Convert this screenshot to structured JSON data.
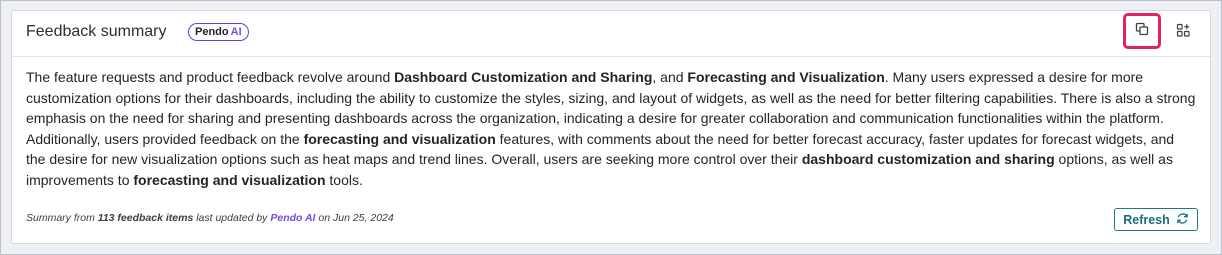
{
  "header": {
    "title": "Feedback summary",
    "badge_main": "Pendo",
    "badge_ai": "AI"
  },
  "icons": {
    "copy": "copy-icon",
    "widget": "add-widget-icon",
    "refresh": "refresh-icon"
  },
  "summary": {
    "p1": "The feature requests and product feedback revolve around ",
    "b1": "Dashboard Customization and Sharing",
    "p2": ", and ",
    "b2": "Forecasting and Visualization",
    "p3": ". Many users expressed a desire for more customization options for their dashboards, including the ability to customize the styles, sizing, and layout of widgets, as well as the need for better filtering capabilities. There is also a strong emphasis on the need for sharing and presenting dashboards across the organization, indicating a desire for greater collaboration and communication functionalities within the platform. Additionally, users provided feedback on the ",
    "b3": "forecasting and visualization",
    "p4": " features, with comments about the need for better forecast accuracy, faster updates for forecast widgets, and the desire for new visualization options such as heat maps and trend lines. Overall, users are seeking more control over their ",
    "b4": "dashboard customization and sharing",
    "p5": " options, as well as improvements to ",
    "b5": "forecasting and visualization",
    "p6": " tools."
  },
  "footer": {
    "prefix": "Summary from ",
    "count": "113 feedback items",
    "mid": " last updated by ",
    "author": "Pendo AI",
    "date_text": " on Jun 25, 2024"
  },
  "actions": {
    "refresh_label": "Refresh"
  },
  "colors": {
    "accent_purple": "#7b4be0",
    "highlight": "#e0245e",
    "teal": "#1b6f7a"
  }
}
